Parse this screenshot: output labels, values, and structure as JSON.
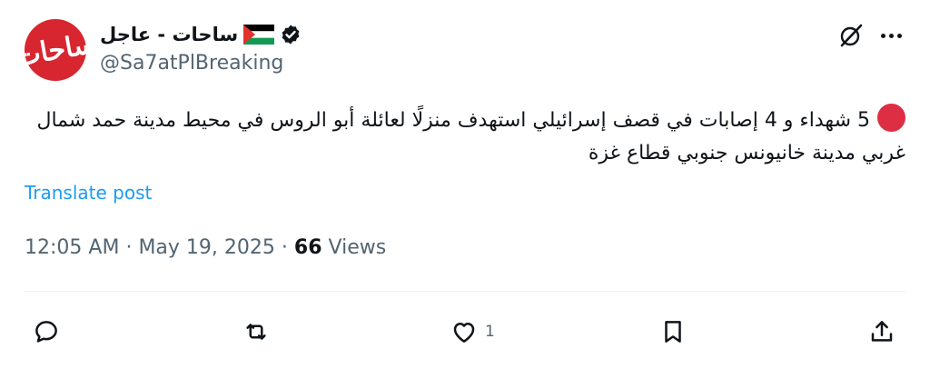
{
  "account": {
    "display_name": "ساحات - عاجل",
    "handle": "@Sa7atPlBreaking",
    "avatar_text": "ساحات",
    "verified": true
  },
  "post": {
    "text": "5 شهداء و 4 إصابات في قصف إسرائيلي استهدف منزلًا لعائلة أبو الروس في محيط مدينة حمد شمال غربي مدينة خانيونس جنوبي قطاع غزة",
    "translate_label": "Translate post",
    "time": "12:05 AM",
    "date": "May 19, 2025",
    "views_count": "66",
    "views_label": "Views"
  },
  "actions": {
    "reply_count": "",
    "repost_count": "",
    "like_count": "1",
    "bookmark_count": ""
  },
  "colors": {
    "accent": "#1d9bf0",
    "avatar_bg": "#d7262f",
    "red_dot": "#dd2e44",
    "muted_text": "#536471"
  },
  "icons": [
    "red-circle-icon",
    "palestine-flag-icon",
    "verified-badge-icon",
    "grok-icon",
    "more-icon",
    "reply-icon",
    "repost-icon",
    "like-icon",
    "bookmark-icon",
    "share-icon"
  ]
}
